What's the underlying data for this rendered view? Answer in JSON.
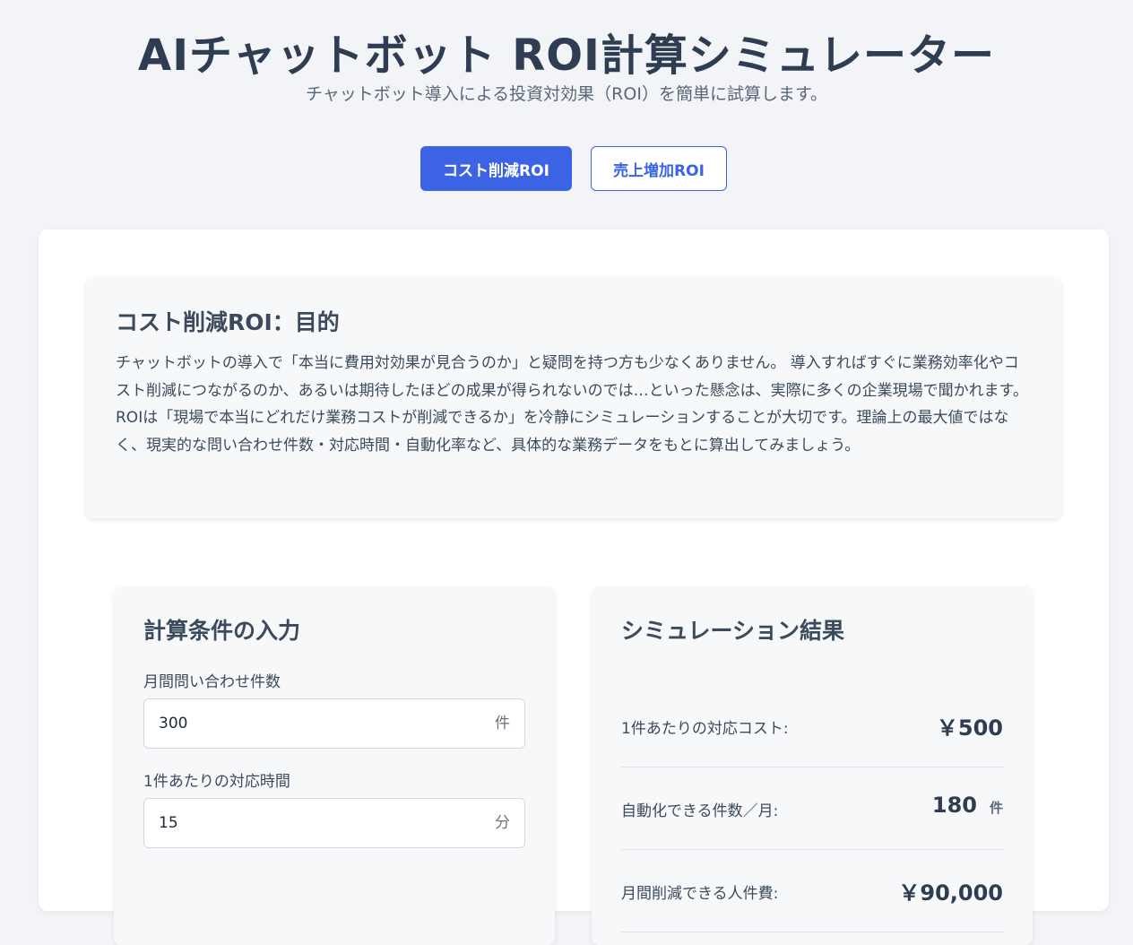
{
  "header": {
    "title": "AIチャットボット ROI計算シミュレーター",
    "subtitle": "チャットボット導入による投資対効果（ROI）を簡単に試算します。"
  },
  "tabs": [
    {
      "label": "コスト削減ROI",
      "active": true
    },
    {
      "label": "売上増加ROI",
      "active": false
    }
  ],
  "purpose": {
    "title": "コスト削減ROI：目的",
    "body": "チャットボットの導入で「本当に費用対効果が見合うのか」と疑問を持つ方も少なくありません。 導入すればすぐに業務効率化やコスト削減につながるのか、あるいは期待したほどの成果が得られないのでは…といった懸念は、実際に多くの企業現場で聞かれます。 ROIは「現場で本当にどれだけ業務コストが削減できるか」を冷静にシミュレーションすることが大切です。理論上の最大値ではなく、現実的な問い合わせ件数・対応時間・自動化率など、具体的な業務データをもとに算出してみましょう。"
  },
  "inputs": {
    "title": "計算条件の入力",
    "fields": [
      {
        "label": "月間問い合わせ件数",
        "value": "300",
        "unit": "件"
      },
      {
        "label": "1件あたりの対応時間",
        "value": "15",
        "unit": "分"
      }
    ]
  },
  "results": {
    "title": "シミュレーション結果",
    "rows": [
      {
        "label": "1件あたりの対応コスト:",
        "value": "￥500",
        "unit": ""
      },
      {
        "label": "自動化できる件数／月:",
        "value": "180",
        "unit": "件"
      },
      {
        "label": "月間削減できる人件費:",
        "value": "￥90,000",
        "unit": ""
      }
    ]
  },
  "colors": {
    "accent": "#3b63e3",
    "background": "#f2f4f7",
    "card": "#ffffff",
    "panel": "#f7f8fa",
    "text": "#3b4a5c"
  }
}
